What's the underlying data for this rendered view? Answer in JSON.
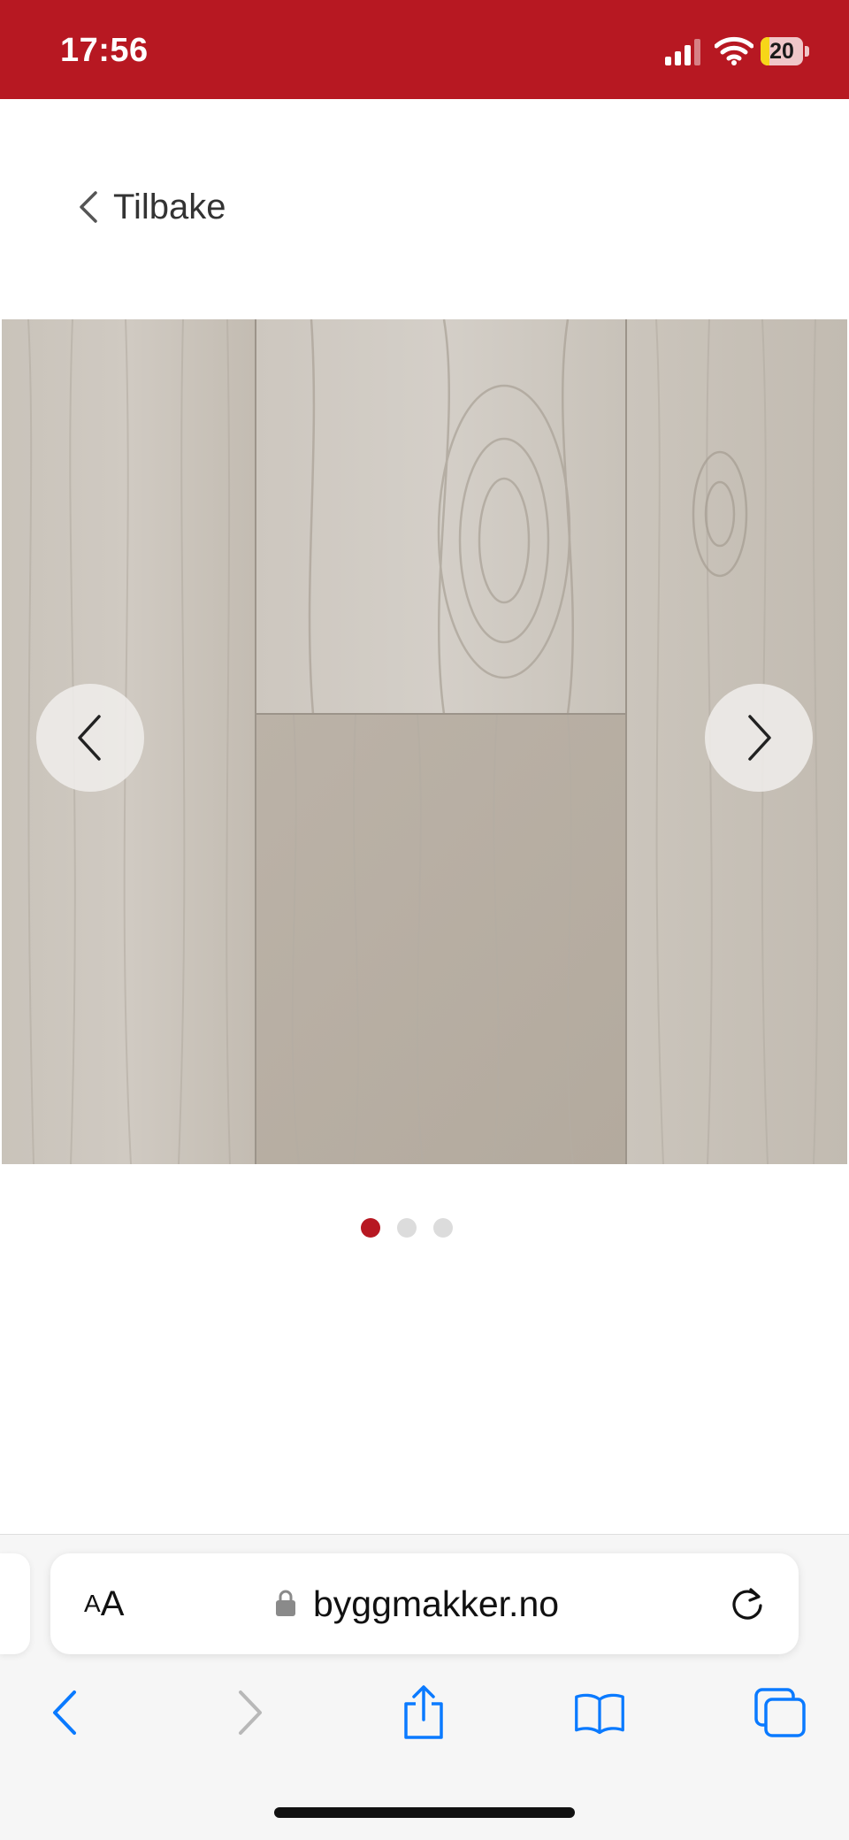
{
  "status_bar": {
    "time": "17:56",
    "battery_level": "20",
    "battery_fraction": 0.2,
    "background_color": "#b71822",
    "icons": [
      "signal-icon",
      "wifi-icon",
      "battery-icon"
    ]
  },
  "header": {
    "back_label": "Tilbake",
    "back_icon": "chevron-left-icon"
  },
  "gallery": {
    "image": "product-image",
    "image_description": "light grey oak wood floor planks",
    "prev_icon": "chevron-left-icon",
    "next_icon": "chevron-right-icon",
    "slide_count": 3,
    "active_slide": 1,
    "active_dot_color": "#b71822",
    "inactive_dot_color": "#dcdcdc"
  },
  "browser": {
    "text_size_label_small": "A",
    "text_size_label_big": "A",
    "url": "byggmakker.no",
    "icons": [
      "lock-icon",
      "reload-icon",
      "back-arrow-icon",
      "forward-arrow-icon",
      "share-icon",
      "bookmarks-icon",
      "tabs-icon"
    ],
    "accent_color": "#0a7aff"
  }
}
